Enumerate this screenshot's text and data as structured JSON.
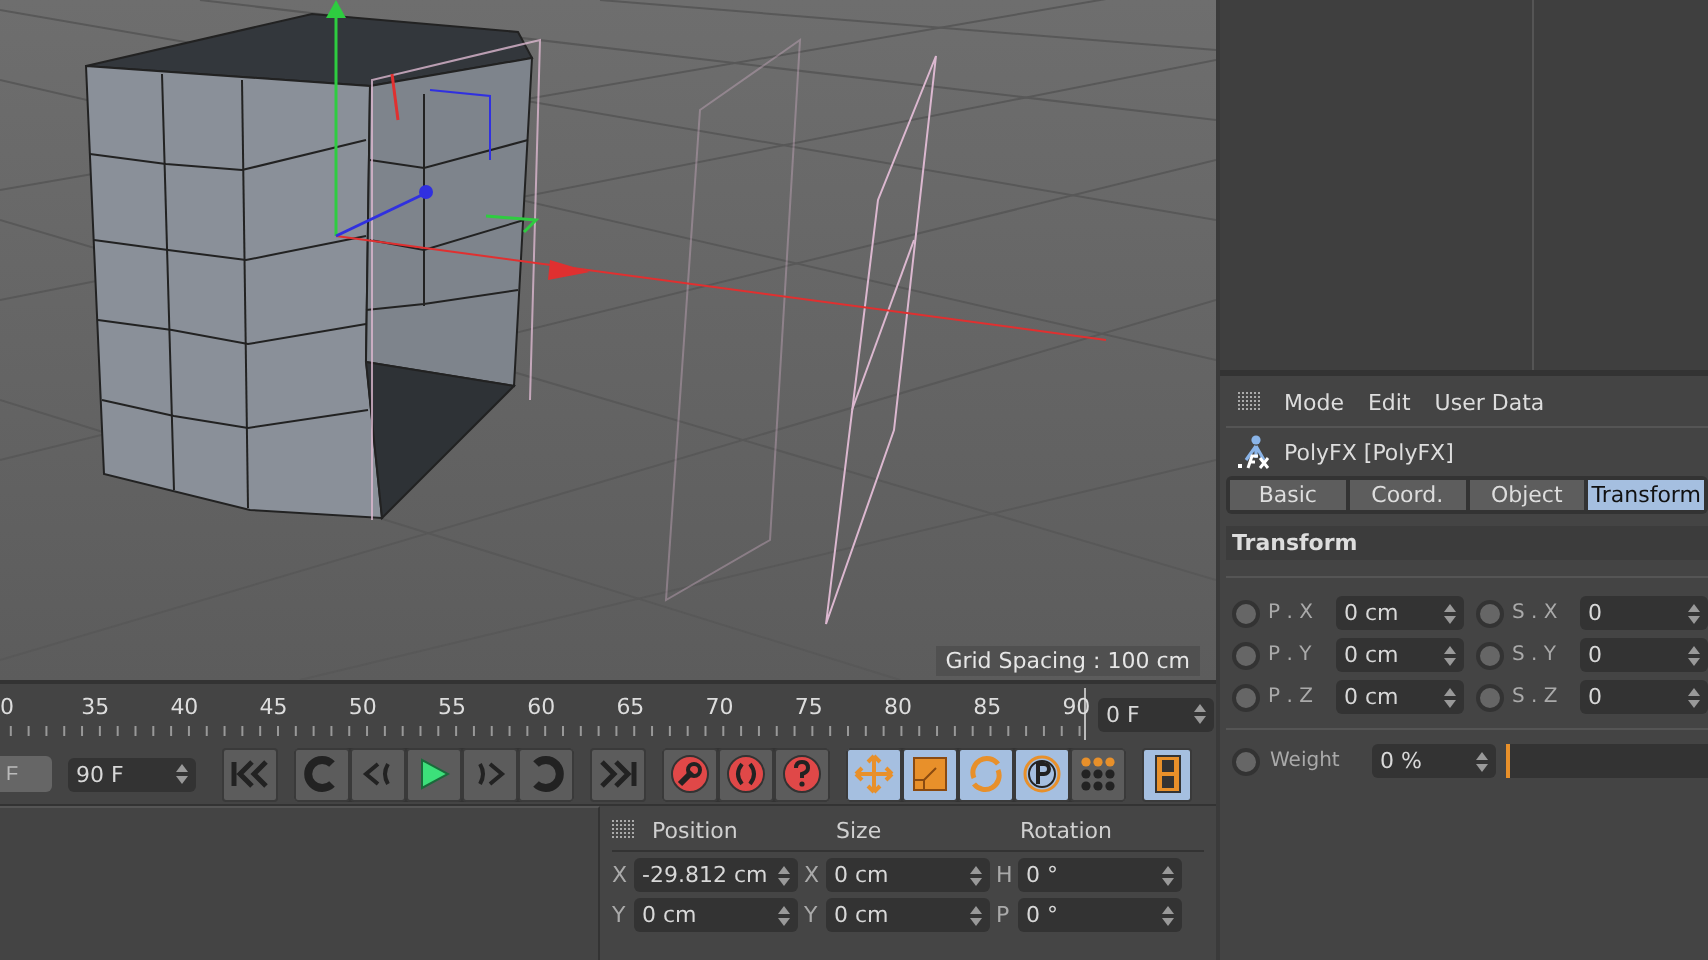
{
  "viewport": {
    "grid_spacing": "Grid Spacing : 100 cm"
  },
  "timeline": {
    "ruler_labels": [
      "0",
      "35",
      "40",
      "45",
      "50",
      "55",
      "60",
      "65",
      "70",
      "75",
      "80",
      "85",
      "90"
    ],
    "current_frame": "0 F",
    "f_button": "F",
    "end_frame": "90 F",
    "key_tools": [
      {
        "kind": "move",
        "on": true
      },
      {
        "kind": "scale",
        "on": true
      },
      {
        "kind": "rotate",
        "on": true
      },
      {
        "kind": "parameter",
        "on": true
      },
      {
        "kind": "points",
        "on": false
      }
    ],
    "film_button": {
      "on": true
    }
  },
  "coordinates": {
    "headers": [
      "Position",
      "Size",
      "Rotation"
    ],
    "rows": [
      {
        "pos_label": "X",
        "pos": "-29.812 cm",
        "size_label": "X",
        "size": "0 cm",
        "rot_label": "H",
        "rot": "0 °"
      },
      {
        "pos_label": "Y",
        "pos": "0 cm",
        "size_label": "Y",
        "size": "0 cm",
        "rot_label": "P",
        "rot": "0 °"
      }
    ]
  },
  "attributes": {
    "menu": [
      "Mode",
      "Edit",
      "User Data"
    ],
    "object_name": "PolyFX [PolyFX]",
    "tabs": [
      {
        "label": "Basic",
        "selected": false
      },
      {
        "label": "Coord.",
        "selected": false
      },
      {
        "label": "Object",
        "selected": false
      },
      {
        "label": "Transform",
        "selected": true
      }
    ],
    "section": "Transform",
    "params": [
      {
        "label": "P . X",
        "value": "0 cm"
      },
      {
        "label": "S . X",
        "value": "0"
      },
      {
        "label": "P . Y",
        "value": "0 cm"
      },
      {
        "label": "S . Y",
        "value": "0"
      },
      {
        "label": "P . Z",
        "value": "0 cm"
      },
      {
        "label": "S . Z",
        "value": "0"
      }
    ],
    "weight": {
      "label": "Weight",
      "value": "0 %",
      "level": 0
    }
  }
}
